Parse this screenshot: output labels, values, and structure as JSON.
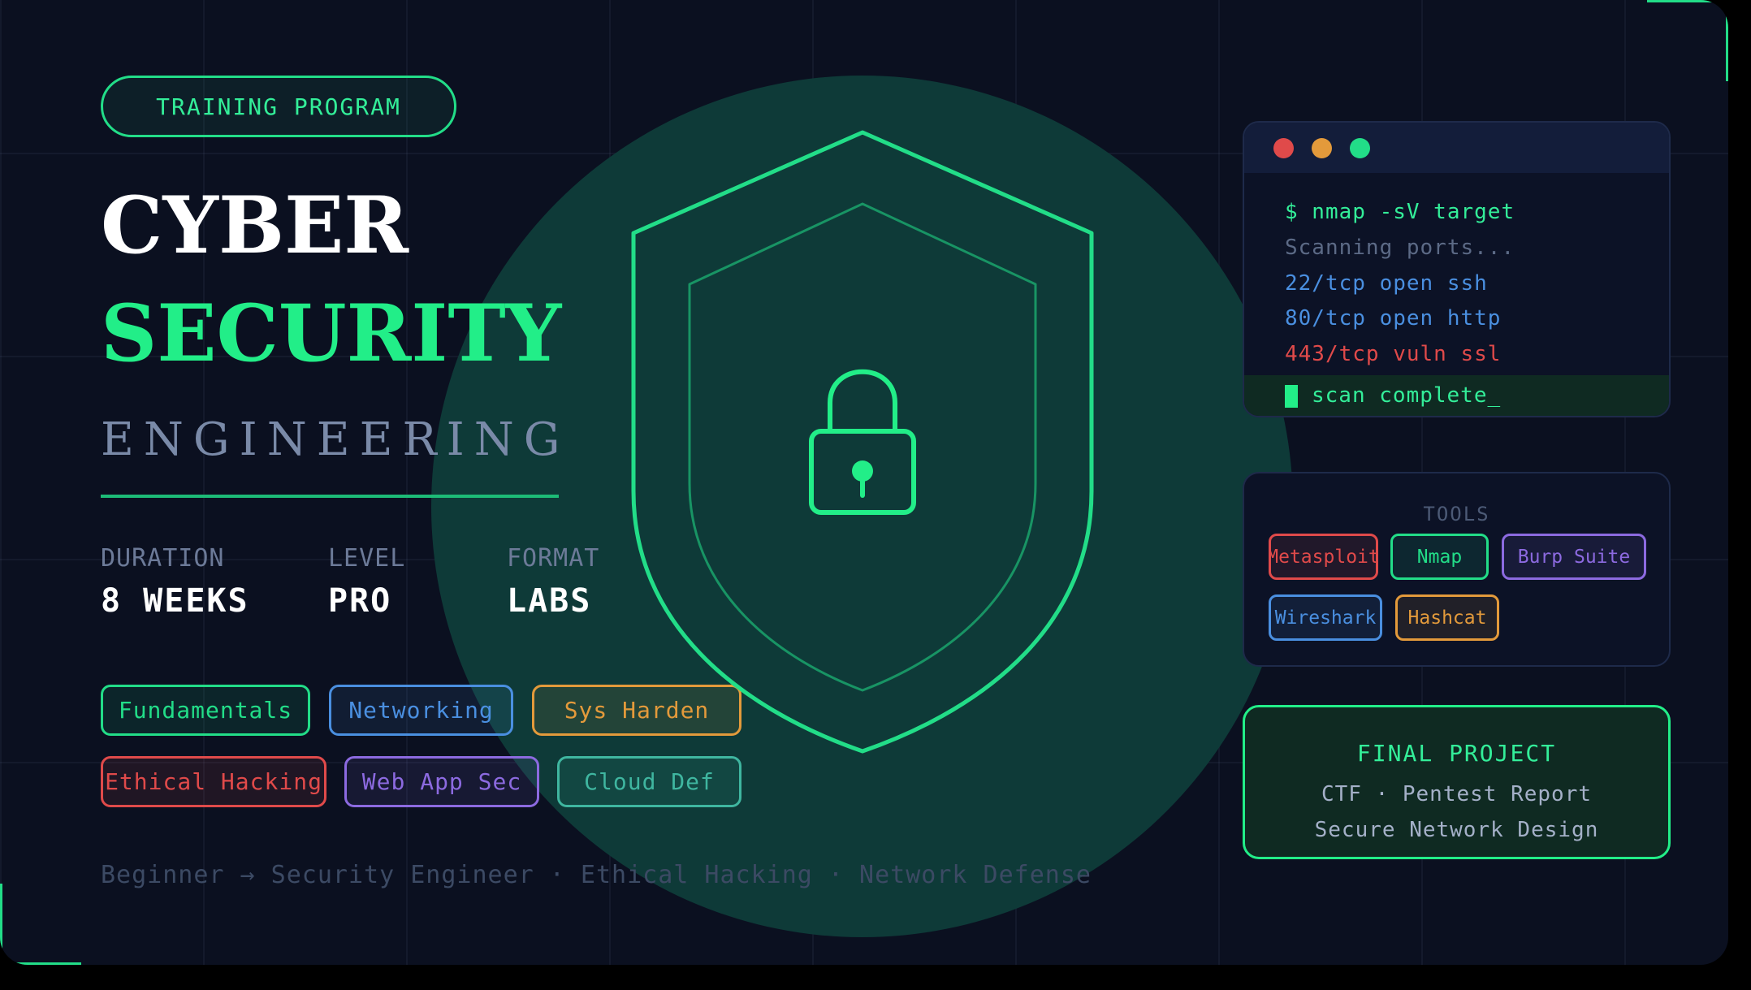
{
  "badge": {
    "label": "TRAINING PROGRAM"
  },
  "title": {
    "line1": "CYBER",
    "line2": "SECURITY",
    "line3": "ENGINEERING"
  },
  "stats": [
    {
      "label": "DURATION",
      "value": "8 WEEKS"
    },
    {
      "label": "LEVEL",
      "value": "PRO"
    },
    {
      "label": "FORMAT",
      "value": "LABS"
    }
  ],
  "topics": [
    {
      "label": "Fundamentals",
      "color": "#22dd88"
    },
    {
      "label": "Networking",
      "color": "#4a8fe0"
    },
    {
      "label": "Sys Harden",
      "color": "#e39a3b"
    },
    {
      "label": "Ethical Hacking",
      "color": "#e04a4a"
    },
    {
      "label": "Web App Sec",
      "color": "#8c6ae0"
    },
    {
      "label": "Cloud Def",
      "color": "#3fb6a0"
    }
  ],
  "tagline": "Beginner → Security Engineer · Ethical Hacking · Network Defense",
  "shield": {
    "icon": "lock-icon",
    "color": "#22dd88"
  },
  "terminal": {
    "lines": [
      {
        "text": "$ nmap -sV target",
        "color": "#33ee99"
      },
      {
        "text": "Scanning ports...",
        "color": "#5c6a86"
      },
      {
        "text": "22/tcp open ssh",
        "color": "#4a8fe0"
      },
      {
        "text": "80/tcp open http",
        "color": "#4a8fe0"
      },
      {
        "text": "443/tcp vuln ssl",
        "color": "#e04a4a"
      }
    ],
    "active_line": "scan complete_",
    "dots": [
      "#e04a4a",
      "#e39a3b",
      "#22dd88"
    ]
  },
  "tools": {
    "title": "TOOLS",
    "items": [
      {
        "label": "Metasploit",
        "color": "#e04a4a"
      },
      {
        "label": "Nmap",
        "color": "#22dd88"
      },
      {
        "label": "Burp Suite",
        "color": "#8c6ae0"
      },
      {
        "label": "Wireshark",
        "color": "#4a8fe0"
      },
      {
        "label": "Hashcat",
        "color": "#e39a3b"
      }
    ]
  },
  "final_project": {
    "title": "FINAL PROJECT",
    "line1": "CTF · Pentest Report",
    "line2": "Secure Network Design"
  },
  "colors": {
    "background": "#0b1020",
    "accent": "#22ee88",
    "halo": "#0e3a38"
  }
}
